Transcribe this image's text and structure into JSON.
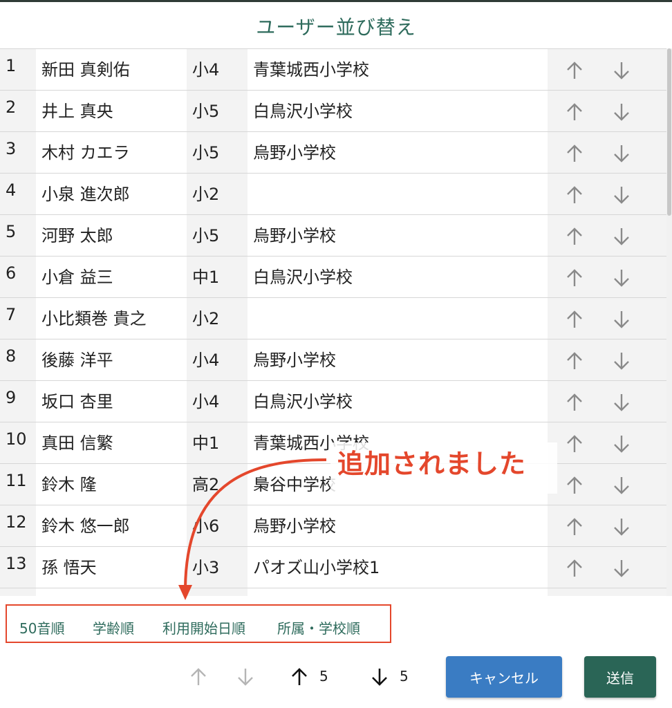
{
  "dialog": {
    "title": "ユーザー並び替え"
  },
  "rows": [
    {
      "num": "1",
      "name": "新田 真剣佑",
      "grade": "小4",
      "school": "青葉城西小学校"
    },
    {
      "num": "2",
      "name": "井上 真央",
      "grade": "小5",
      "school": "白鳥沢小学校"
    },
    {
      "num": "3",
      "name": "木村 カエラ",
      "grade": "小5",
      "school": "烏野小学校"
    },
    {
      "num": "4",
      "name": "小泉 進次郎",
      "grade": "小2",
      "school": ""
    },
    {
      "num": "5",
      "name": "河野 太郎",
      "grade": "小5",
      "school": "烏野小学校"
    },
    {
      "num": "6",
      "name": "小倉 益三",
      "grade": "中1",
      "school": "白鳥沢小学校"
    },
    {
      "num": "7",
      "name": "小比類巻 貴之",
      "grade": "小2",
      "school": ""
    },
    {
      "num": "8",
      "name": "後藤 洋平",
      "grade": "小4",
      "school": "烏野小学校"
    },
    {
      "num": "9",
      "name": "坂口 杏里",
      "grade": "小4",
      "school": "白鳥沢小学校"
    },
    {
      "num": "10",
      "name": "真田 信繁",
      "grade": "中1",
      "school": "青葉城西小学校"
    },
    {
      "num": "11",
      "name": "鈴木 隆",
      "grade": "高2",
      "school": "梟谷中学校"
    },
    {
      "num": "12",
      "name": "鈴木 悠一郎",
      "grade": "小6",
      "school": "烏野小学校"
    },
    {
      "num": "13",
      "name": "孫 悟天",
      "grade": "小3",
      "school": "パオズ山小学校1"
    },
    {
      "num": "",
      "name": "",
      "grade": "",
      "school": ""
    }
  ],
  "annotation": {
    "text": "追加されました",
    "color": "#e4472c"
  },
  "sort_options": {
    "kana": "50音順",
    "age": "学齢順",
    "start_date": "利用開始日順",
    "school": "所属・学校順"
  },
  "bottom_controls": {
    "up_count": "5",
    "down_count": "5",
    "cancel_label": "キャンセル",
    "submit_label": "送信"
  },
  "colors": {
    "accent_green": "#2e6b5c",
    "cancel_blue": "#3a7cc3",
    "submit_green": "#2a6556",
    "arrow_gray": "#8a8a8a"
  },
  "icons": {
    "row_up": "arrow-up-icon",
    "row_down": "arrow-down-icon"
  }
}
